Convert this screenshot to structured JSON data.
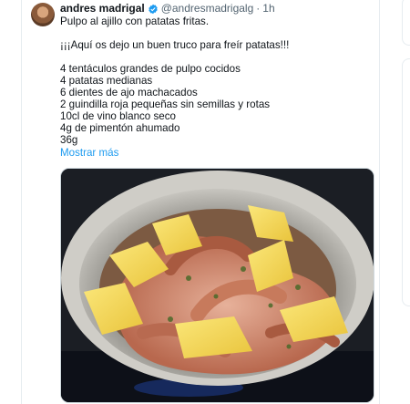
{
  "tweet": {
    "author_name": "andres madrigal",
    "handle": "@andresmadrigalg",
    "separator": "·",
    "time": "1h",
    "lines": [
      "Pulpo al ajillo con patatas fritas.",
      "",
      "¡¡¡Aquí os dejo un buen truco para freír patatas!!!",
      "",
      "4 tentáculos grandes de pulpo cocidos",
      "4 patatas medianas",
      "6 dientes de ajo machacados",
      "2 guindilla roja pequeñas sin semillas y rotas",
      "10cl de vino blanco seco",
      "4g de pimentón ahumado",
      "36g"
    ],
    "show_more": "Mostrar más"
  },
  "colors": {
    "text": "#0f1419",
    "secondary": "#536471",
    "link": "#1d9bf0",
    "verified": "#1d9bf0",
    "border": "#e6ecf0"
  },
  "icons": {
    "verified": "verified-badge-icon"
  }
}
